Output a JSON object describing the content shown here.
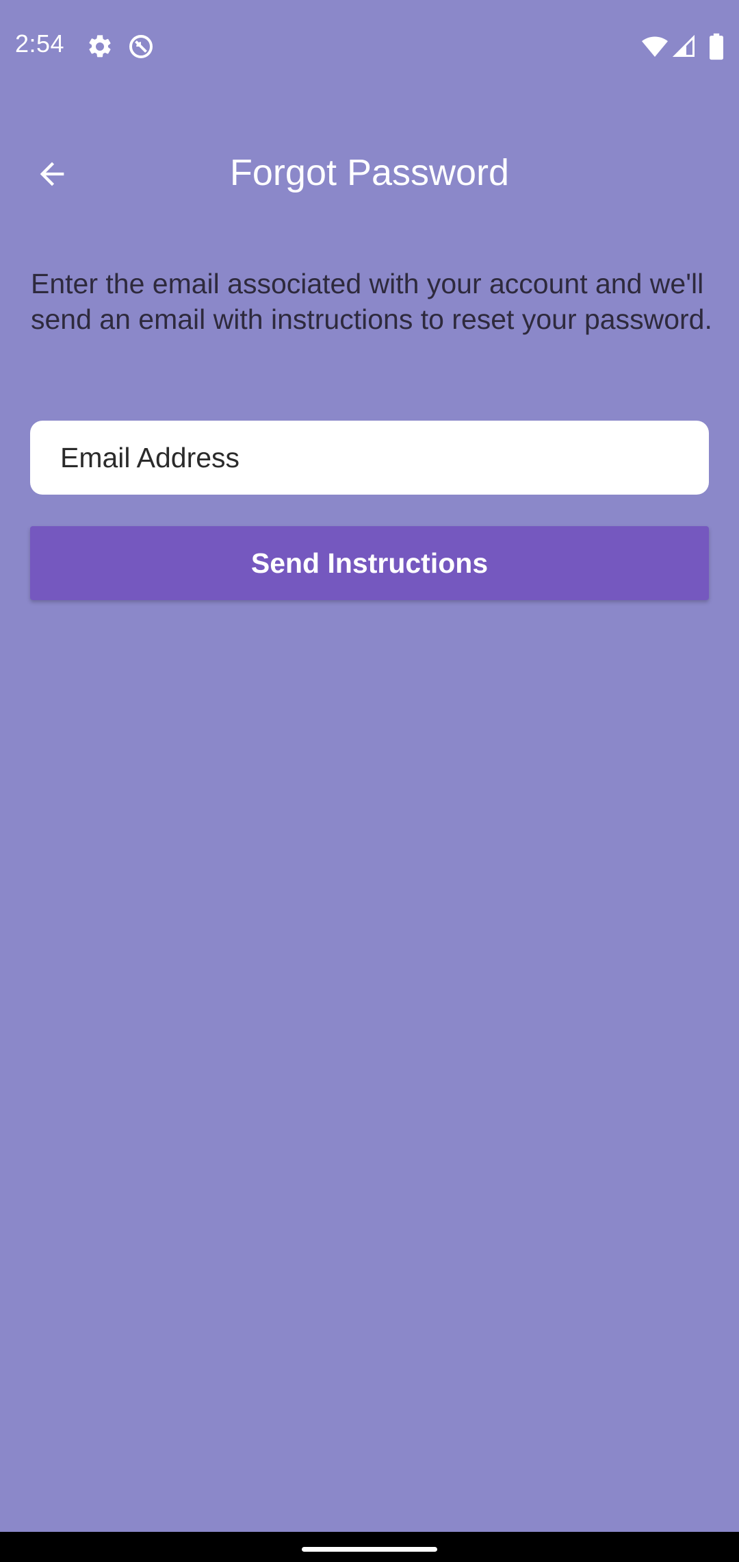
{
  "status_bar": {
    "time": "2:54",
    "icons": [
      "settings-gear-icon",
      "do-not-disturb-icon",
      "wifi-icon",
      "cellular-signal-icon",
      "battery-icon"
    ]
  },
  "app_bar": {
    "title": "Forgot Password",
    "back_icon": "arrow-back-icon"
  },
  "main": {
    "instructions": "Enter the email associated with your account and we'll send an email with instructions to reset your password.",
    "email_field": {
      "placeholder": "Email Address",
      "value": ""
    },
    "send_button_label": "Send Instructions"
  },
  "colors": {
    "background": "#8b88c9",
    "button": "#7558bf",
    "field": "#ffffff",
    "text_dark": "#2e2a3d",
    "text_light": "#ffffff"
  }
}
